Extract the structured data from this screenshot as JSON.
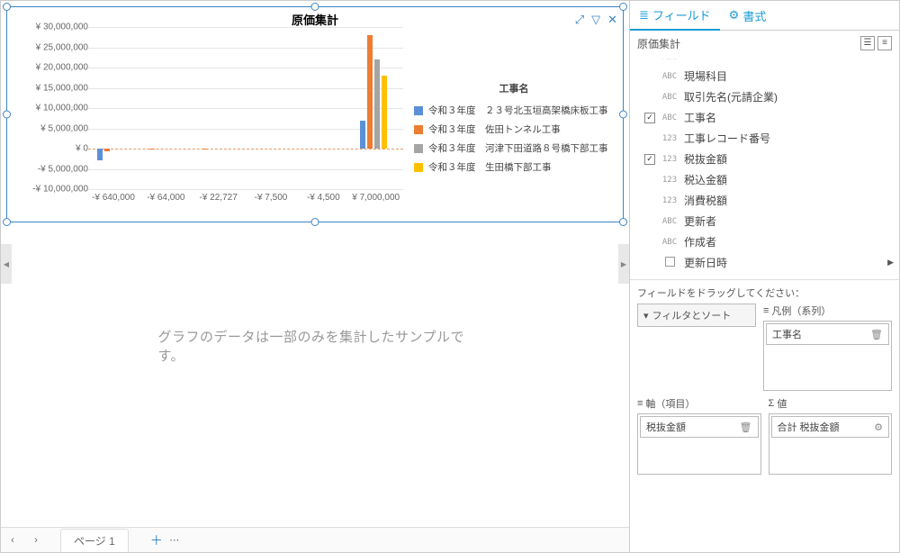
{
  "chart": {
    "title": "原価集計",
    "toolbar": {
      "expand": "⤢",
      "filter": "▽",
      "close": "✕"
    }
  },
  "chart_data": {
    "type": "bar",
    "title": "原価集計",
    "legend_title": "工事名",
    "series": [
      {
        "name": "令和３年度　２３号北玉垣高架橋床板工事",
        "color": "#5b8fd6"
      },
      {
        "name": "令和３年度　佐田トンネル工事",
        "color": "#ed7d31"
      },
      {
        "name": "令和３年度　河津下田道路８号橋下部工事",
        "color": "#a5a5a5"
      },
      {
        "name": "令和３年度　生田橋下部工事",
        "color": "#ffc000"
      }
    ],
    "y_ticks": [
      "¥ 30,000,000",
      "¥ 25,000,000",
      "¥ 20,000,000",
      "¥ 15,000,000",
      "¥ 10,000,000",
      "¥ 5,000,000",
      "¥ 0",
      "-¥ 5,000,000",
      "-¥ 10,000,000"
    ],
    "x_labels": [
      "-¥ 640,000",
      "-¥ 64,000",
      "-¥ 22,727",
      "-¥ 7,500",
      "-¥ 4,500",
      "¥ 7,000,000"
    ],
    "ylim": [
      -10000000,
      30000000
    ],
    "groups": [
      {
        "x": -640000,
        "bars": [
          {
            "series": 0,
            "value": -2800000
          },
          {
            "series": 1,
            "value": -640000
          }
        ]
      },
      {
        "x": -64000,
        "bars": [
          {
            "series": 1,
            "value": -64000
          }
        ]
      },
      {
        "x": -22727,
        "bars": [
          {
            "series": 1,
            "value": -22727
          }
        ]
      },
      {
        "x": -7500,
        "bars": [
          {
            "series": 1,
            "value": -7500
          }
        ]
      },
      {
        "x": -4500,
        "bars": [
          {
            "series": 1,
            "value": -4500
          }
        ]
      },
      {
        "x": 7000000,
        "bars": [
          {
            "series": 0,
            "value": 7000000
          },
          {
            "series": 1,
            "value": 28000000
          },
          {
            "series": 2,
            "value": 22000000
          },
          {
            "series": 3,
            "value": 18000000
          }
        ]
      }
    ]
  },
  "sample_note": "グラフのデータは一部のみを集計したサンプルです。",
  "footer": {
    "prev": "‹",
    "next": "›",
    "page_label": "ページ 1",
    "add": "＋",
    "more": "⋯"
  },
  "side": {
    "tab_fields": "フィールド",
    "tab_format": "書式",
    "section_title": "原価集計",
    "fields": [
      {
        "type": "ABC",
        "label": "",
        "checked": false,
        "partial": true
      },
      {
        "type": "ABC",
        "label": "現場科目",
        "checked": false
      },
      {
        "type": "ABC",
        "label": "取引先名(元請企業)",
        "checked": false
      },
      {
        "type": "ABC",
        "label": "工事名",
        "checked": true
      },
      {
        "type": "123",
        "label": "工事レコード番号",
        "checked": false
      },
      {
        "type": "123",
        "label": "税抜金額",
        "checked": true
      },
      {
        "type": "123",
        "label": "税込金額",
        "checked": false
      },
      {
        "type": "123",
        "label": "消費税額",
        "checked": false
      },
      {
        "type": "ABC",
        "label": "更新者",
        "checked": false
      },
      {
        "type": "ABC",
        "label": "作成者",
        "checked": false
      },
      {
        "type": "CAL",
        "label": "更新日時",
        "checked": false,
        "expandable": true
      }
    ],
    "drag_hint": "フィールドをドラッグしてください：",
    "zone_filter": "フィルタとソート",
    "zone_legend": "凡例（系列）",
    "legend_pill": "工事名",
    "zone_axis": "軸（項目）",
    "axis_pill": "税抜金額",
    "zone_values": "値",
    "values_pill": "合計 税抜金額"
  }
}
